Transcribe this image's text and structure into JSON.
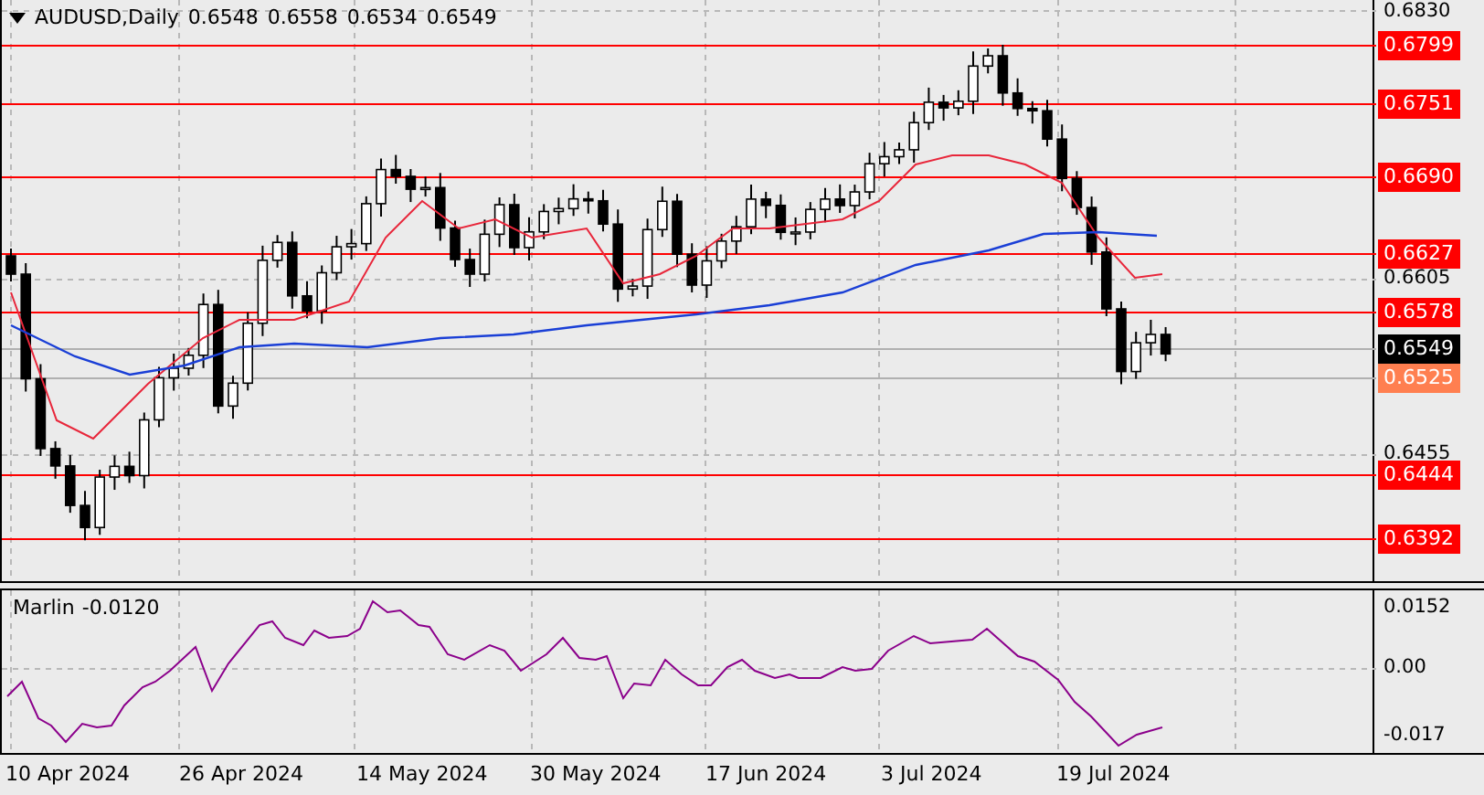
{
  "header": {
    "symbol": "AUDUSD,Daily",
    "quotes": [
      "0.6548",
      "0.6558",
      "0.6534",
      "0.6549"
    ]
  },
  "price_axis": {
    "ticks": [
      "0.6830",
      "0.6605",
      "0.6455"
    ],
    "levels": [
      {
        "label": "0.6799",
        "kind": "level"
      },
      {
        "label": "0.6751",
        "kind": "level"
      },
      {
        "label": "0.6690",
        "kind": "level"
      },
      {
        "label": "0.6627",
        "kind": "level"
      },
      {
        "label": "0.6578",
        "kind": "level"
      },
      {
        "label": "0.6549",
        "kind": "bid"
      },
      {
        "label": "0.6525",
        "kind": "mark"
      },
      {
        "label": "0.6444",
        "kind": "level"
      },
      {
        "label": "0.6392",
        "kind": "level"
      }
    ]
  },
  "indicator": {
    "name": "Marlin",
    "value": "-0.0120",
    "ticks": [
      "0.0152",
      "0.00",
      "-0.017"
    ]
  },
  "dates": [
    "10 Apr 2024",
    "26 Apr 2024",
    "14 May 2024",
    "30 May 2024",
    "17 Jun 2024",
    "3 Jul 2024",
    "19 Jul 2024"
  ]
}
